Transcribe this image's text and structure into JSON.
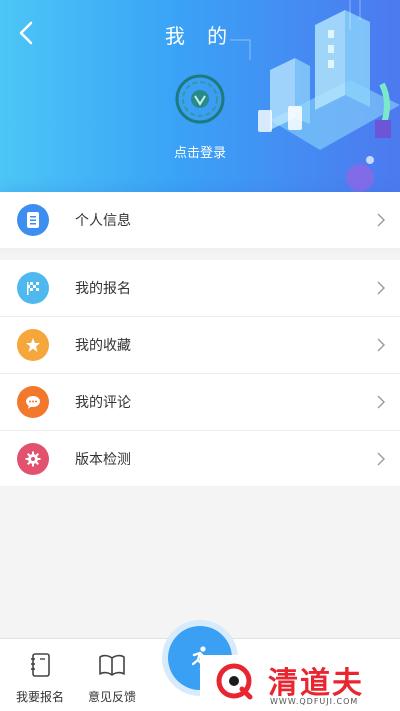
{
  "header": {
    "title": "我 的",
    "login_label": "点击登录"
  },
  "menu": {
    "profile": {
      "label": "个人信息",
      "icon": "document-icon",
      "color": "#3d8ef0"
    },
    "items": [
      {
        "label": "我的报名",
        "icon": "flag-icon",
        "color": "#4fb9ef"
      },
      {
        "label": "我的收藏",
        "icon": "star-icon",
        "color": "#f5a73b"
      },
      {
        "label": "我的评论",
        "icon": "chat-bubble-icon",
        "color": "#f2792c"
      },
      {
        "label": "版本检测",
        "icon": "gear-icon",
        "color": "#e2526f"
      }
    ]
  },
  "tabbar": {
    "tabs": [
      {
        "label": "我要报名",
        "icon": "notebook-icon"
      },
      {
        "label": "意见反馈",
        "icon": "book-icon"
      }
    ],
    "active_color": "#3aa0f3"
  },
  "watermark": {
    "name": "清道夫",
    "url": "WWW.QDFUJI.COM"
  }
}
